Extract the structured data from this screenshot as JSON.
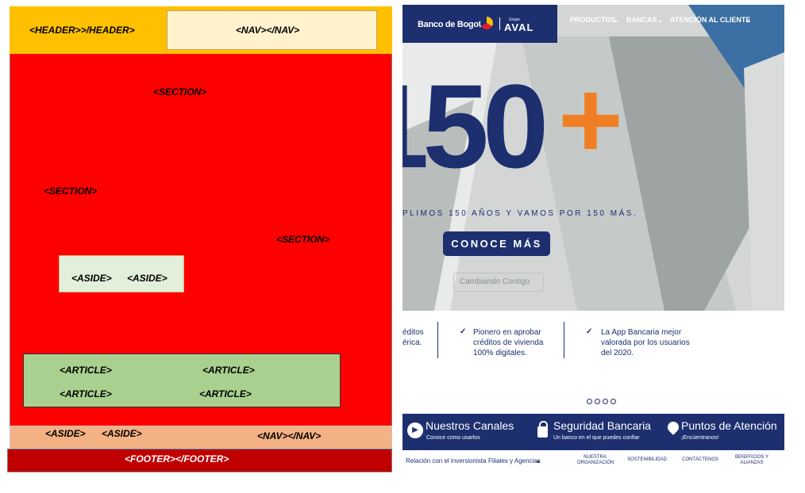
{
  "diagram": {
    "header_label": "<HEADER>>/HEADER>",
    "nav_top_label": "<NAV></NAV>",
    "section1_label": "<SECTION>",
    "section2_label": "<SECTION>",
    "section3_label": "<SECTION>",
    "aside_inner_label1": "<ASIDE>",
    "aside_inner_label2": "<ASIDE>",
    "articles": [
      "<ARTICLE>",
      "<ARTICLE>",
      "<ARTICLE>",
      "<ARTICLE>"
    ],
    "aside_bottom_label1": "<ASIDE>",
    "aside_bottom_label2": "<ASIDE>",
    "nav_bottom_label": "<NAV></NAV>",
    "footer_label": "<FOOTER></FOOTER>",
    "colors": {
      "header": "#ffc000",
      "nav": "#fff2cc",
      "main": "#ff0000",
      "aside": "#e2efda",
      "article": "#a9d08e",
      "bottom": "#f4b183",
      "footer": "#c00000"
    }
  },
  "site": {
    "brand": "Banco de Bogotá",
    "group_small": "Grupo",
    "group": "AVAL",
    "nav": [
      "PRODUCTOS",
      "BANCAS",
      "ATENCIÓN AL CLIENTE"
    ],
    "hero_number": "150",
    "hero_plus": "+",
    "hero_tagline": "PLIMOS 150 AÑOS Y VAMOS POR 150 MÁS.",
    "cta": "CONOCE MÁS",
    "campaign": "Cambiando Contigo",
    "features": [
      "éditos\nérica.",
      "Pionero en aprobar\ncréditos de vivienda\n100% digitales.",
      "La App Bancaria mejor\nvalorada por los usuarios\ndel 2020."
    ],
    "channels": [
      {
        "title": "Nuestros Canales",
        "sub": "Conoce como usarlos",
        "icon": "play-icon"
      },
      {
        "title": "Seguridad Bancaria",
        "sub": "Un banco en el que puedes confiar",
        "icon": "lock-icon"
      },
      {
        "title": "Puntos de Atención",
        "sub": "¡Encúentranos!",
        "icon": "location-pin-icon"
      }
    ],
    "footer": {
      "link1": "Relación con el inversionista",
      "link2": "Filiales y Agencias",
      "small": [
        "NUESTRA\nORGANIZACIÓN",
        "SOSTENIBILIDAD",
        "CONTÁCTENOS",
        "BENEFICIOS Y\nALIANZAS"
      ]
    }
  }
}
